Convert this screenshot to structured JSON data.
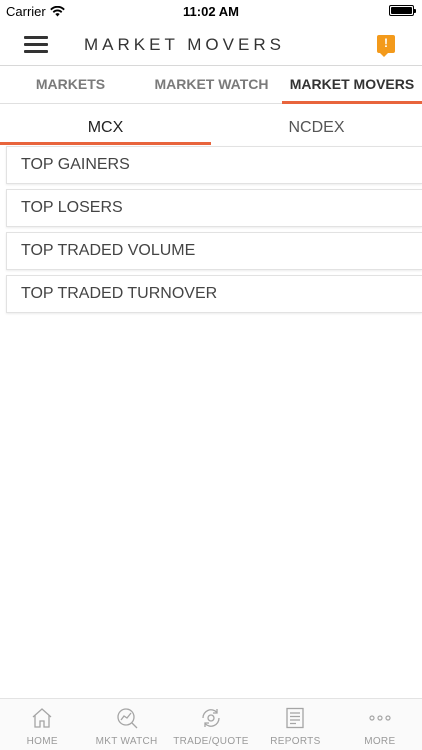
{
  "status_bar": {
    "carrier": "Carrier",
    "time": "11:02 AM"
  },
  "header": {
    "title": "MARKET MOVERS",
    "alert_icon": "!"
  },
  "main_tabs": [
    {
      "label": "MARKETS"
    },
    {
      "label": "MARKET WATCH"
    },
    {
      "label": "MARKET MOVERS"
    }
  ],
  "sub_tabs": [
    {
      "label": "MCX"
    },
    {
      "label": "NCDEX"
    }
  ],
  "list_items": [
    {
      "label": "TOP GAINERS"
    },
    {
      "label": "TOP LOSERS"
    },
    {
      "label": "TOP TRADED VOLUME"
    },
    {
      "label": "TOP TRADED TURNOVER"
    }
  ],
  "bottom_nav": [
    {
      "label": "HOME",
      "icon": "home-icon"
    },
    {
      "label": "MKT WATCH",
      "icon": "chart-magnifier-icon"
    },
    {
      "label": "TRADE/QUOTE",
      "icon": "trade-quote-icon"
    },
    {
      "label": "REPORTS",
      "icon": "report-icon"
    },
    {
      "label": "MORE",
      "icon": "more-dots-icon"
    }
  ],
  "colors": {
    "accent": "#e8643c",
    "alert": "#f39a1b"
  }
}
